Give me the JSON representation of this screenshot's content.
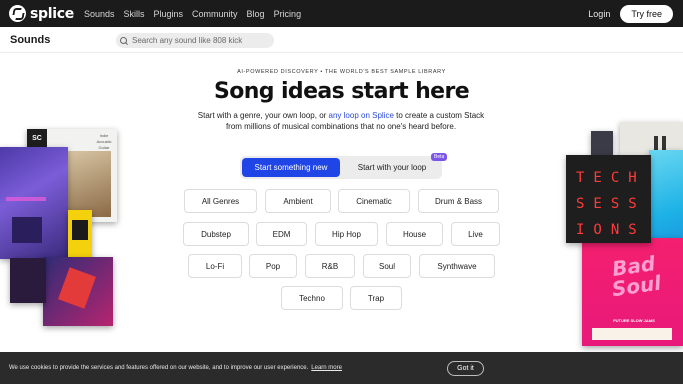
{
  "nav": {
    "logo_text": "splice",
    "links": [
      "Sounds",
      "Skills",
      "Plugins",
      "Community",
      "Blog",
      "Pricing"
    ],
    "login": "Login",
    "try_free": "Try free"
  },
  "subheader": {
    "title": "Sounds",
    "search_placeholder": "Search any sound like 808 kick"
  },
  "hero": {
    "eyebrow": "AI-POWERED DISCOVERY • THE WORLD'S BEST SAMPLE LIBRARY",
    "headline": "Song ideas start here",
    "subtext_before": "Start with a genre, your own loop, or ",
    "subtext_link": "any loop on Splice",
    "subtext_after": " to create a custom Stack from millions of musical combinations that no one's heard before."
  },
  "toggle": {
    "active": "Start something new",
    "inactive": "Start with your loop",
    "badge": "Beta"
  },
  "genres": [
    [
      "All Genres",
      "Ambient",
      "Cinematic",
      "Drum & Bass"
    ],
    [
      "Dubstep",
      "EDM",
      "Hip Hop",
      "House",
      "Live"
    ],
    [
      "Lo-Fi",
      "Pop",
      "R&B",
      "Soul",
      "Synthwave"
    ],
    [
      "Techno",
      "Trap"
    ]
  ],
  "art": {
    "sc_label": "SC",
    "indie_label": "Indie Acoustic Guitar",
    "tech_label": "TECH SESSIONS",
    "tech_lines": [
      "TECH",
      "SESS",
      "IONS"
    ],
    "soul_label": "Bad Soul",
    "soul_caption": "FUTURE SLOW JAMS"
  },
  "cookie": {
    "text": "We use cookies to provide the services and features offered on our website, and to improve our user experience.",
    "learn_more": "Learn more",
    "got_it": "Got it"
  },
  "colors": {
    "accent": "#1f45e6",
    "nav_bg": "#1b1b1b",
    "beta": "#7c54e8"
  }
}
